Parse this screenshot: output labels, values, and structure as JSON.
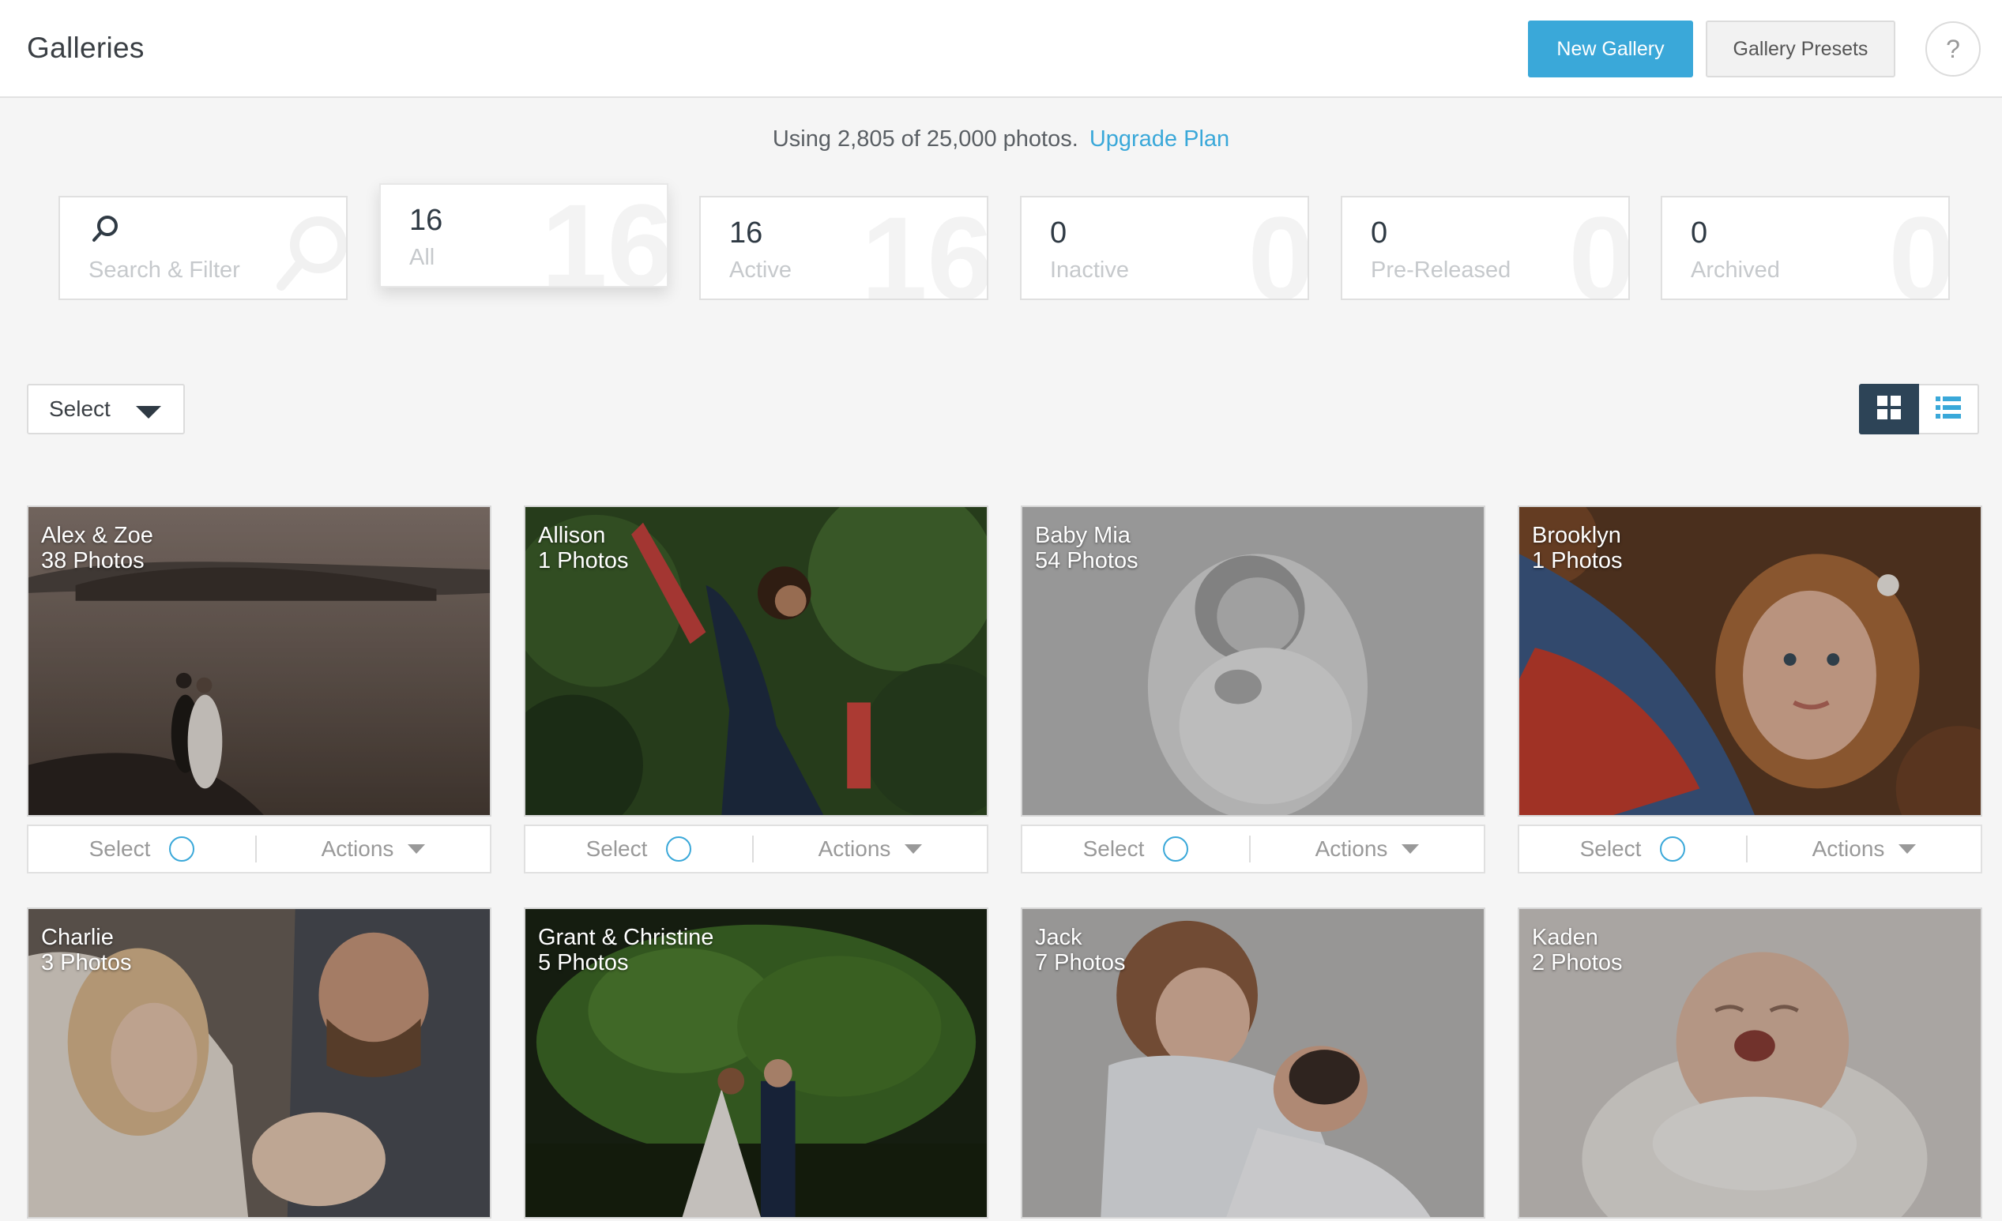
{
  "header": {
    "title": "Galleries",
    "new_gallery_label": "New Gallery",
    "gallery_presets_label": "Gallery Presets",
    "help_label": "?"
  },
  "usage": {
    "text": "Using 2,805 of 25,000 photos.",
    "upgrade_label": "Upgrade Plan"
  },
  "filters": [
    {
      "number": "",
      "label": "Search & Filter",
      "icon": "search-icon"
    },
    {
      "number": "16",
      "label": "All",
      "selected": true
    },
    {
      "number": "16",
      "label": "Active"
    },
    {
      "number": "0",
      "label": "Inactive"
    },
    {
      "number": "0",
      "label": "Pre-Released"
    },
    {
      "number": "0",
      "label": "Archived"
    }
  ],
  "toolbar": {
    "select_label": "Select",
    "view_mode": "grid"
  },
  "card_labels": {
    "select": "Select",
    "actions": "Actions"
  },
  "galleries": [
    {
      "name": "Alex & Zoe",
      "count": "38 Photos"
    },
    {
      "name": "Allison",
      "count": "1 Photos"
    },
    {
      "name": "Baby Mia",
      "count": "54 Photos"
    },
    {
      "name": "Brooklyn",
      "count": "1 Photos"
    },
    {
      "name": "Charlie",
      "count": "3 Photos"
    },
    {
      "name": "Grant & Christine",
      "count": "5 Photos"
    },
    {
      "name": "Jack",
      "count": "7 Photos"
    },
    {
      "name": "Kaden",
      "count": "2 Photos"
    }
  ],
  "colors": {
    "accent": "#3aa8d9",
    "dark_toggle": "#2d4457",
    "background": "#f5f5f5"
  }
}
